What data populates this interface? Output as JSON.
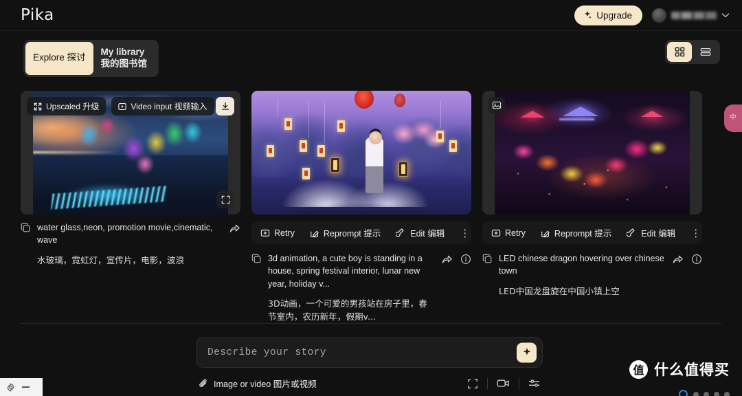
{
  "header": {
    "logo": "Pika",
    "upgrade_label": "Upgrade",
    "upgrade_icon": "sparkle-icon",
    "chevron": "⌄"
  },
  "tabs": [
    {
      "label": "Explore 探讨",
      "active": true
    },
    {
      "label": "My library 我的图书馆",
      "active": false
    }
  ],
  "view_toggle": [
    {
      "name": "grid-view",
      "active": true
    },
    {
      "name": "list-view",
      "active": false
    }
  ],
  "cards": [
    {
      "id": "card-1",
      "badges": [
        {
          "icon": "expand-icon",
          "label": "Upscaled 升级"
        },
        {
          "icon": "play-icon",
          "label": "Video input 视频输入"
        }
      ],
      "download_icon": "download-icon",
      "expand_icon": "fullscreen-icon",
      "caption_en": "water glass,neon, promotion movie,cinematic, wave",
      "caption_zh": "水玻璃，霓虹灯，宣传片，电影，波浪",
      "copy_icon": "copy-icon",
      "share_icon": "share-icon",
      "has_actions": false
    },
    {
      "id": "card-2",
      "image_badge": null,
      "actions": [
        {
          "icon": "retry-icon",
          "label": "Retry"
        },
        {
          "icon": "reprompt-icon",
          "label": "Reprompt 提示"
        },
        {
          "icon": "edit-icon",
          "label": "Edit 编辑"
        }
      ],
      "more_label": "⋮",
      "caption_en": "3d animation, a cute boy is standing in a house, spring festival interior, lunar new year, holiday v...",
      "caption_zh": "3D动画，一个可爱的男孩站在房子里，春节室内，农历新年，假期v...",
      "copy_icon": "copy-icon",
      "share_icon": "share-icon",
      "info_icon": "info-icon",
      "has_actions": true
    },
    {
      "id": "card-3",
      "image_badge": "image-icon",
      "actions": [
        {
          "icon": "retry-icon",
          "label": "Retry"
        },
        {
          "icon": "reprompt-icon",
          "label": "Reprompt 提示"
        },
        {
          "icon": "edit-icon",
          "label": "Edit 编辑"
        }
      ],
      "more_label": "⋮",
      "caption_en": "LED chinese dragon hovering over chinese town",
      "caption_zh": "LED中国龙盘旋在中国小镇上空",
      "copy_icon": "copy-icon",
      "share_icon": "share-icon",
      "info_icon": "info-icon",
      "has_actions": true
    }
  ],
  "composer": {
    "placeholder": "Describe your story",
    "value": "",
    "generate_icon": "sparkle-icon",
    "attach_label": "Image or video 图片或视频",
    "attach_icon": "paperclip-icon",
    "tools": [
      {
        "name": "aspect-ratio-icon"
      },
      {
        "name": "video-camera-icon"
      },
      {
        "name": "settings-sliders-icon"
      }
    ]
  },
  "edge_pill": {
    "label": "中"
  },
  "watermark": {
    "logo": "值",
    "text": "什么值得买"
  },
  "colors": {
    "background": "#111111",
    "accent_cream": "#f7e7c9",
    "panel": "#1c1c1c",
    "toolbar": "#191919",
    "edge_pill": "#c05478"
  }
}
